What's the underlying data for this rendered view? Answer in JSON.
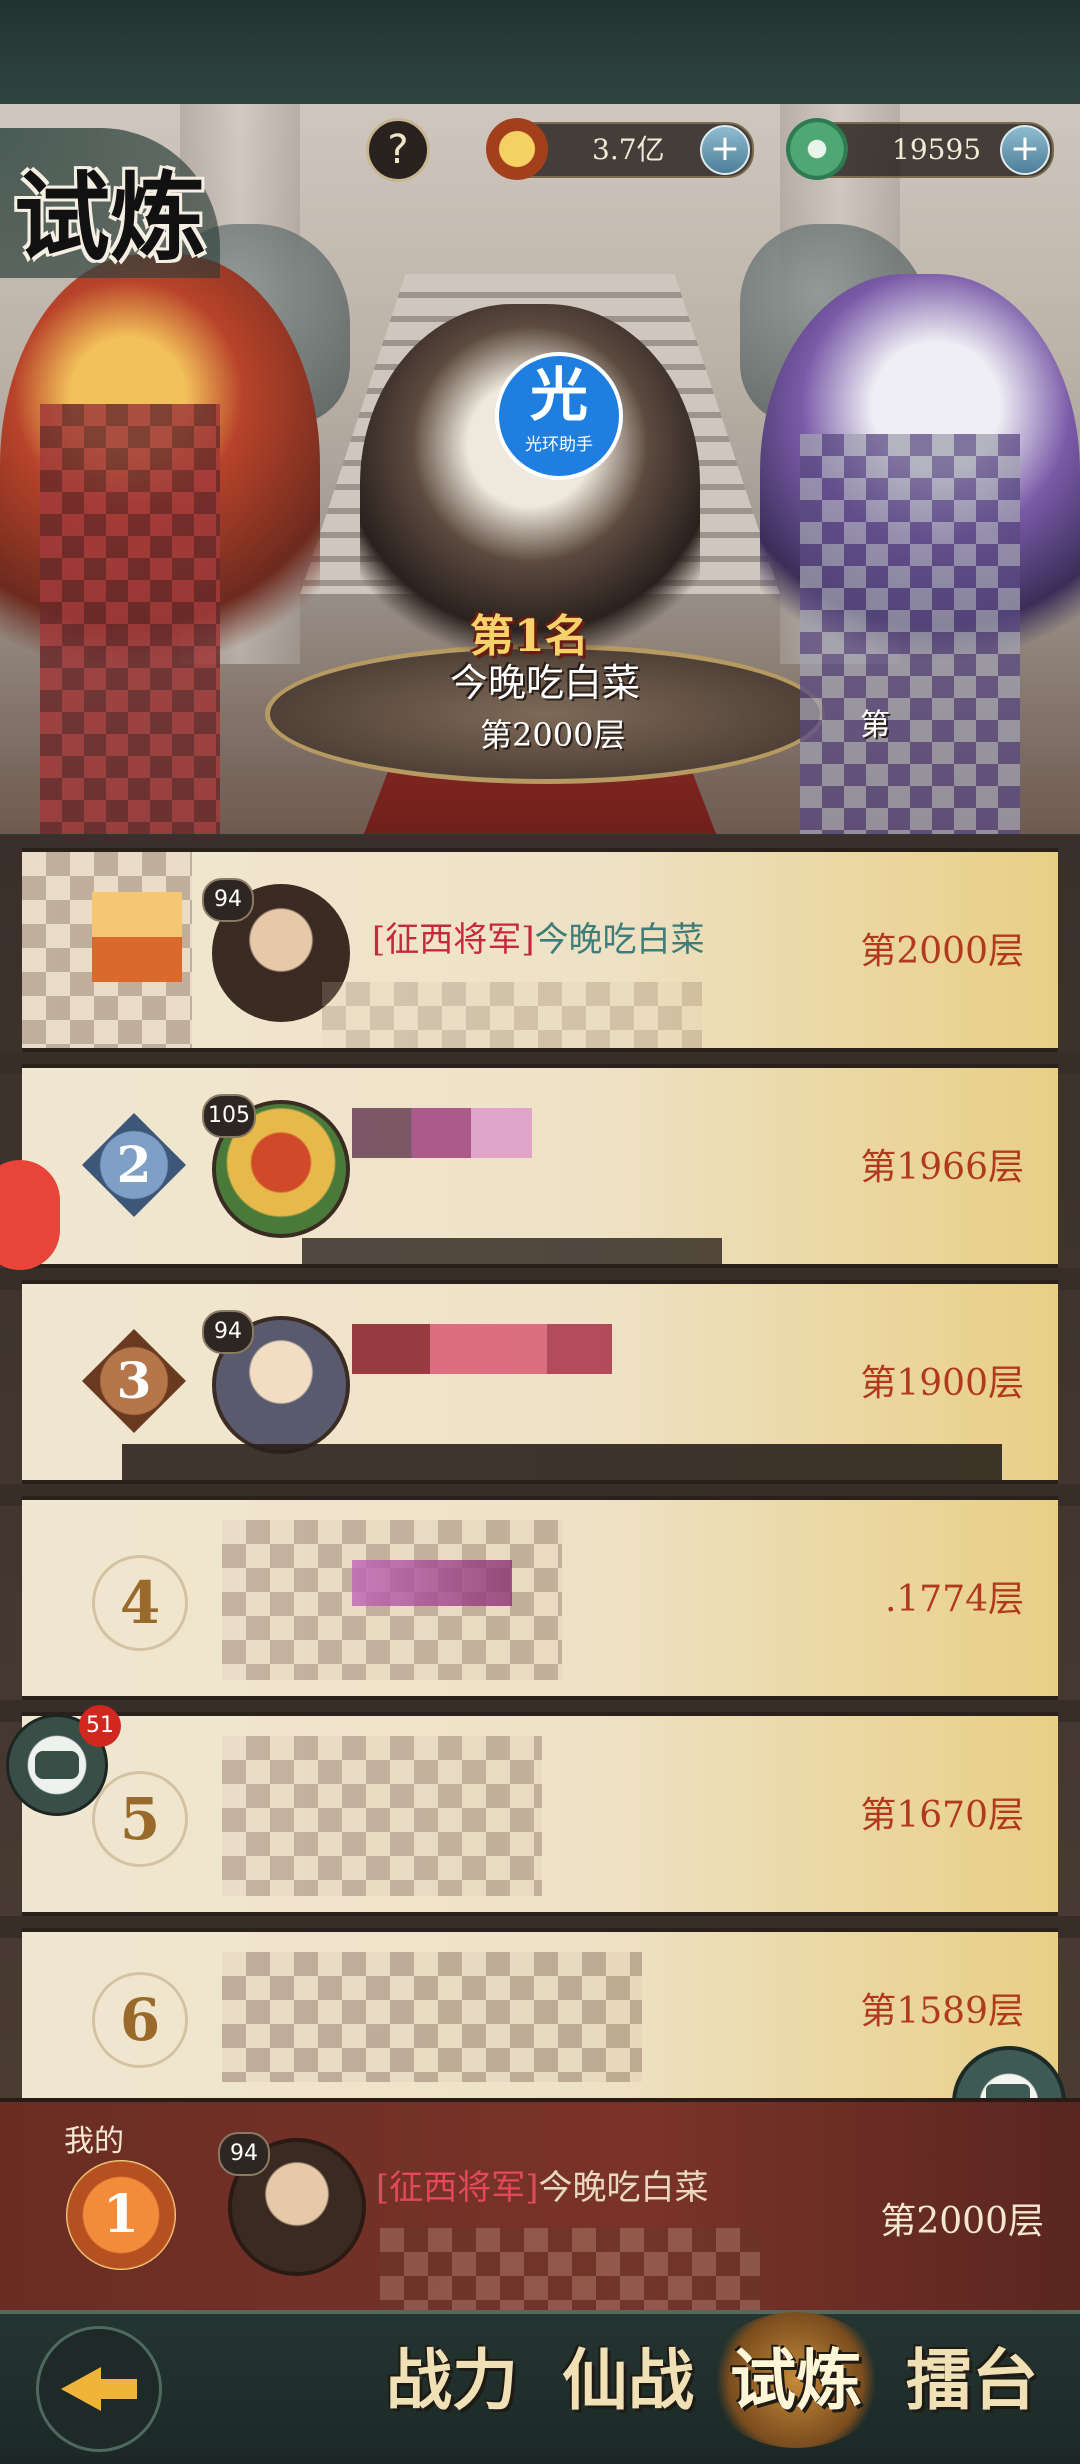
{
  "page": {
    "title": "试炼",
    "help_icon": "question-icon"
  },
  "resources": {
    "gold": {
      "icon": "gold-coin-icon",
      "value": "3.7亿"
    },
    "jade": {
      "icon": "jade-icon",
      "value": "19595"
    }
  },
  "podium": {
    "rank_label": "第1名",
    "player_name": "今晚吃白菜",
    "floor": "第2000层",
    "watermark": "光环助手",
    "watermark_char": "光",
    "side_rank_fragment": "第"
  },
  "rankings": [
    {
      "rank": "1",
      "level": "94",
      "title": "[征西将军]",
      "name": "今晚吃白菜",
      "floor": "第2000层"
    },
    {
      "rank": "2",
      "level": "105",
      "title": "",
      "name": "",
      "floor": "第1966层"
    },
    {
      "rank": "3",
      "level": "94",
      "title": "",
      "name": "",
      "floor": "第1900层"
    },
    {
      "rank": "4",
      "level": "",
      "title": "",
      "name": "",
      "floor": ".1774层"
    },
    {
      "rank": "5",
      "level": "",
      "title": "",
      "name": "",
      "floor": "第1670层"
    },
    {
      "rank": "6",
      "level": "",
      "title": "",
      "name": "",
      "floor": "第1589层"
    }
  ],
  "my_rank": {
    "label": "我的",
    "rank": "1",
    "level": "94",
    "title": "[征西将军]",
    "name": "今晚吃白菜",
    "floor": "第2000层"
  },
  "chat": {
    "icon": "chat-bubble-icon",
    "badge": "51"
  },
  "nav": {
    "back_icon": "back-arrow-icon",
    "tabs": [
      "战力",
      "仙战",
      "试炼",
      "擂台"
    ],
    "active": "试炼"
  },
  "colors": {
    "title_red": "#c32a3e",
    "name_teal": "#3f7d7b",
    "floor_red": "#b0391e",
    "gold": "#e8cf86"
  }
}
